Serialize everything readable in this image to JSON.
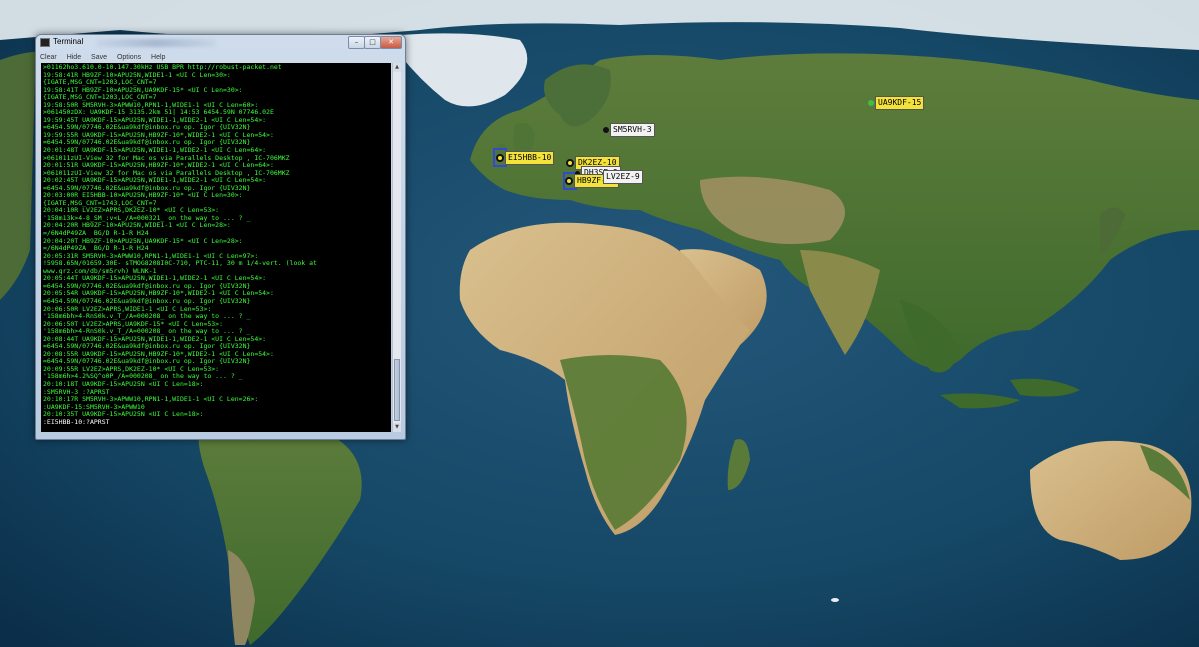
{
  "terminal": {
    "title": "Terminal",
    "menu": [
      "Clear",
      "Hide",
      "Save",
      "Options",
      "Help"
    ],
    "buttons": {
      "minimize": "–",
      "maximize": "□",
      "close": "✕"
    },
    "lines": [
      ">01162ho3.610.0-10.147.30kHz USB BPR http://robust-packet.net",
      "19:58:41R HB9ZF-10>APU25N,WIDE1-1 <UI C Len=30>:",
      "{IGATE,MSG_CNT=1203,LOC_CNT=7",
      "19:58:41T HB9ZF-10>APU25N,UA9KDF-15* <UI C Len=30>:",
      "{IGATE,MSG_CNT=1203,LOC_CNT=7",
      "19:58:50R SM5RVH-3>APWW10,RPN1-1,WIDE1-1 <UI C Len=60>:",
      ">061450zDX: UA9KDF-15 3135.2km 51| 14:53 6454.59N 07746.02E",
      "19:59:45T UA9KDF-15>APU25N,WIDE1-1,WIDE2-1 <UI C Len=54>:",
      "=6454.59N/07746.02E&ua9kdf@inbox.ru op. Igor {UIV32N}",
      "19:59:55R UA9KDF-15>APU25N,HB9ZF-10*,WIDE2-1 <UI C Len=54>:",
      "=6454.59N/07746.02E&ua9kdf@inbox.ru op. Igor {UIV32N}",
      "20:01:48T UA9KDF-15>APU25N,WIDE1-1,WIDE2-1 <UI C Len=64>:",
      ">061011zUI-View 32 for Mac os via Parallels Desktop , IC-706MKZ",
      "20:01:51R UA9KDF-15>APU25N,HB9ZF-10*,WIDE2-1 <UI C Len=64>:",
      ">061011zUI-View 32 for Mac os via Parallels Desktop , IC-706MKZ",
      "20:02:45T UA9KDF-15>APU25N,WIDE1-1,WIDE2-1 <UI C Len=54>:",
      "=6454.59N/07746.02E&ua9kdf@inbox.ru op. Igor {UIV32N}",
      "20:03:00R EI5HBB-10>APU25N,HB9ZF-10* <UI C Len=30>:",
      "{IGATE,MSG_CNT=1743,LOC_CNT=7",
      "20:04:10R LV2EZ>APRS,DK2EZ-10* <UI C Len=53>:",
      "'158m13k>4-8_SM_:v<L_/A=000321_ on the way to ... ? _",
      "20:04:20R HB9ZF-10>APU25N,WIDE1-1 <UI C Len=28>:",
      "=/6N4dP49ZA  BG/D R-1-R H24",
      "20:04:20T HB9ZF-10>APU25N,UA9KDF-15* <UI C Len=28>:",
      "=/6N4dP49ZA  BG/D R-1-R H24",
      "20:05:31R SM5RVH-3>APWW10,RPN1-1,WIDE1-1 <UI C Len=97>:",
      "!5958.65N/01659.30E- sTMOG8208I0C-710, PTC-11, 30 m 1/4-vert. (look at",
      "www.qrz.com/db/sm5rvh) WLNK-1",
      "20:05:44T UA9KDF-15>APU25N,WIDE1-1,WIDE2-1 <UI C Len=54>:",
      "=6454.59N/07746.02E&ua9kdf@inbox.ru op. Igor {UIV32N}",
      "20:05:54R UA9KDF-15>APU25N,HB9ZF-10*,WIDE2-1 <UI C Len=54>:",
      "=6454.59N/07746.02E&ua9kdf@inbox.ru op. Igor {UIV32N}",
      "20:06:50R LV2EZ>APRS,WIDE1-1 <UI C Len=53>:",
      "'158m6bh>4-RnS0k.v_T_/A=000208_ on the way to ... ? _",
      "20:06:50T LV2EZ>APRS,UA9KDF-15* <UI C Len=53>:",
      "'158m6bh>4-RnS0k.v_T_/A=000208_ on the way to ... ? _",
      "20:08:44T UA9KDF-15>APU25N,WIDE1-1,WIDE2-1 <UI C Len=54>:",
      "=6454.59N/07746.02E&ua9kdf@inbox.ru op. Igor {UIV32N}",
      "20:08:55R UA9KDF-15>APU25N,HB9ZF-10*,WIDE2-1 <UI C Len=54>:",
      "=6454.59N/07746.02E&ua9kdf@inbox.ru op. Igor {UIV32N}",
      "20:09:55R LV2EZ>APRS,DK2EZ-10* <UI C Len=53>:",
      "'158m6h>4.2%SQ^o0P_/A=000208_ on the way to ... ? _",
      "20:10:18T UA9KDF-15>APU25N <UI C Len=18>:",
      ":SM5RVH-3 :?APRST",
      "20:10:17R SM5RVH-3>APWW10,RPN1-1,WIDE1-1 <UI C Len=26>:",
      ":UA9KDF-15:SM5RVH-3>APWW10",
      "20:10:35T UA9KDF-15>APU25N <UI C Len=18>:",
      ":EI5HBB-10:?APRST"
    ]
  },
  "stations": [
    {
      "name": "station-ua9kdf",
      "callsign": "UA9KDF-15",
      "style": "yellow",
      "dot": "green"
    },
    {
      "name": "station-sm5rvh",
      "callsign": "SM5RVH-3",
      "style": "white",
      "dot": "dark"
    },
    {
      "name": "station-ei5hbb",
      "callsign": "EI5HBB-10",
      "style": "yellow",
      "dot": "ring"
    },
    {
      "name": "station-dk2ez",
      "callsign": "DK2EZ-10",
      "style": "yellow",
      "dot": "ring"
    },
    {
      "name": "station-dh3sf",
      "callsign": "DH3SF-9",
      "style": "white",
      "dot": "dark"
    },
    {
      "name": "station-hb9zf",
      "callsign": "HB9ZF-10",
      "style": "yellow",
      "dot": "ring"
    },
    {
      "name": "station-lv2ez",
      "callsign": "LV2EZ-9",
      "style": "white",
      "dot": "dark"
    }
  ]
}
